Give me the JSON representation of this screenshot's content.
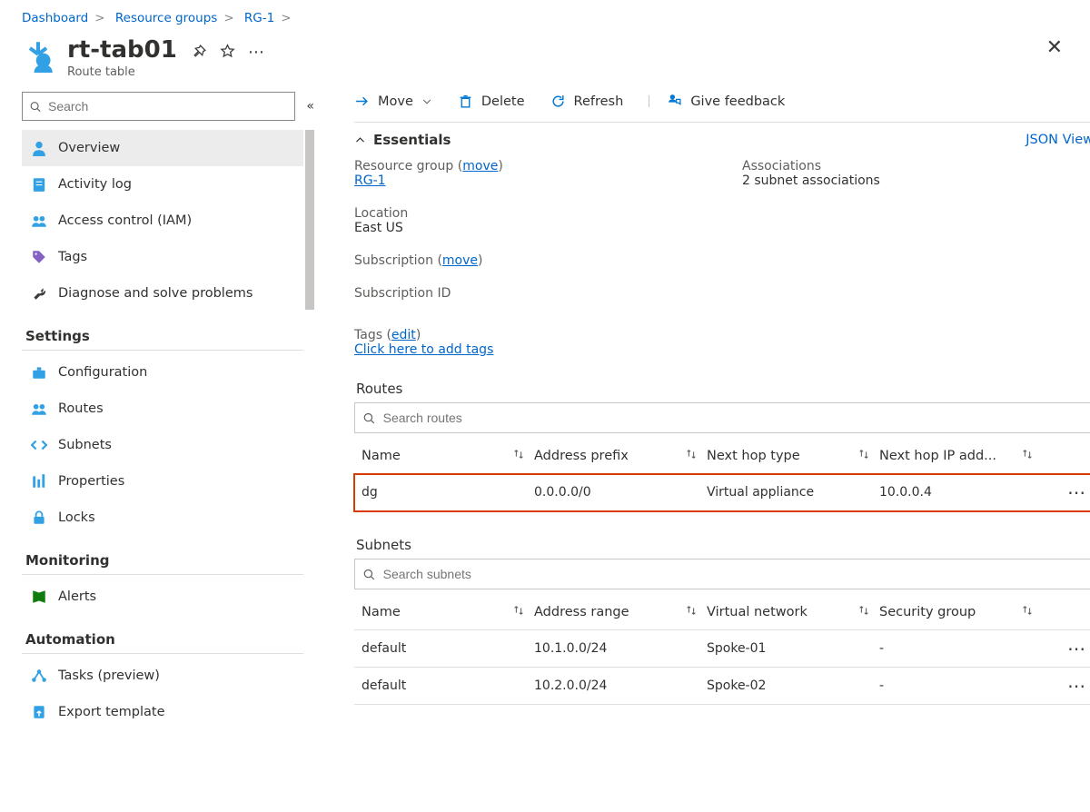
{
  "breadcrumbs": {
    "c0": "Dashboard",
    "c1": "Resource groups",
    "c2": "RG-1"
  },
  "header": {
    "title": "rt-tab01",
    "subtitle": "Route table"
  },
  "sidebar": {
    "search_placeholder": "Search",
    "items": {
      "overview": "Overview",
      "activity": "Activity log",
      "iam": "Access control (IAM)",
      "tags": "Tags",
      "diagnose": "Diagnose and solve problems"
    },
    "h_settings": "Settings",
    "settings": {
      "config": "Configuration",
      "routes": "Routes",
      "subnets": "Subnets",
      "props": "Properties",
      "locks": "Locks"
    },
    "h_monitor": "Monitoring",
    "monitor": {
      "alerts": "Alerts"
    },
    "h_auto": "Automation",
    "auto": {
      "tasks": "Tasks (preview)",
      "export": "Export template"
    }
  },
  "cmd": {
    "move": "Move",
    "delete": "Delete",
    "refresh": "Refresh",
    "feedback": "Give feedback"
  },
  "essentials": {
    "label": "Essentials",
    "json": "JSON View",
    "rg_key": "Resource group",
    "rg_move": "move",
    "rg_val": "RG-1",
    "assoc_key": "Associations",
    "assoc_val": "2 subnet associations",
    "loc_key": "Location",
    "loc_val": "East US",
    "sub_key": "Subscription",
    "sub_move": "move",
    "sid_key": "Subscription ID",
    "tags_key": "Tags",
    "tags_edit": "edit",
    "tags_add": "Click here to add tags"
  },
  "routes": {
    "heading": "Routes",
    "search_placeholder": "Search routes",
    "col_name": "Name",
    "col_prefix": "Address prefix",
    "col_hop": "Next hop type",
    "col_ip": "Next hop IP add...",
    "r0": {
      "name": "dg",
      "prefix": "0.0.0.0/0",
      "hop": "Virtual appliance",
      "ip": "10.0.0.4"
    }
  },
  "subnets": {
    "heading": "Subnets",
    "search_placeholder": "Search subnets",
    "col_name": "Name",
    "col_range": "Address range",
    "col_vnet": "Virtual network",
    "col_sg": "Security group",
    "s0": {
      "name": "default",
      "range": "10.1.0.0/24",
      "vnet": "Spoke-01",
      "sg": "-"
    },
    "s1": {
      "name": "default",
      "range": "10.2.0.0/24",
      "vnet": "Spoke-02",
      "sg": "-"
    }
  }
}
